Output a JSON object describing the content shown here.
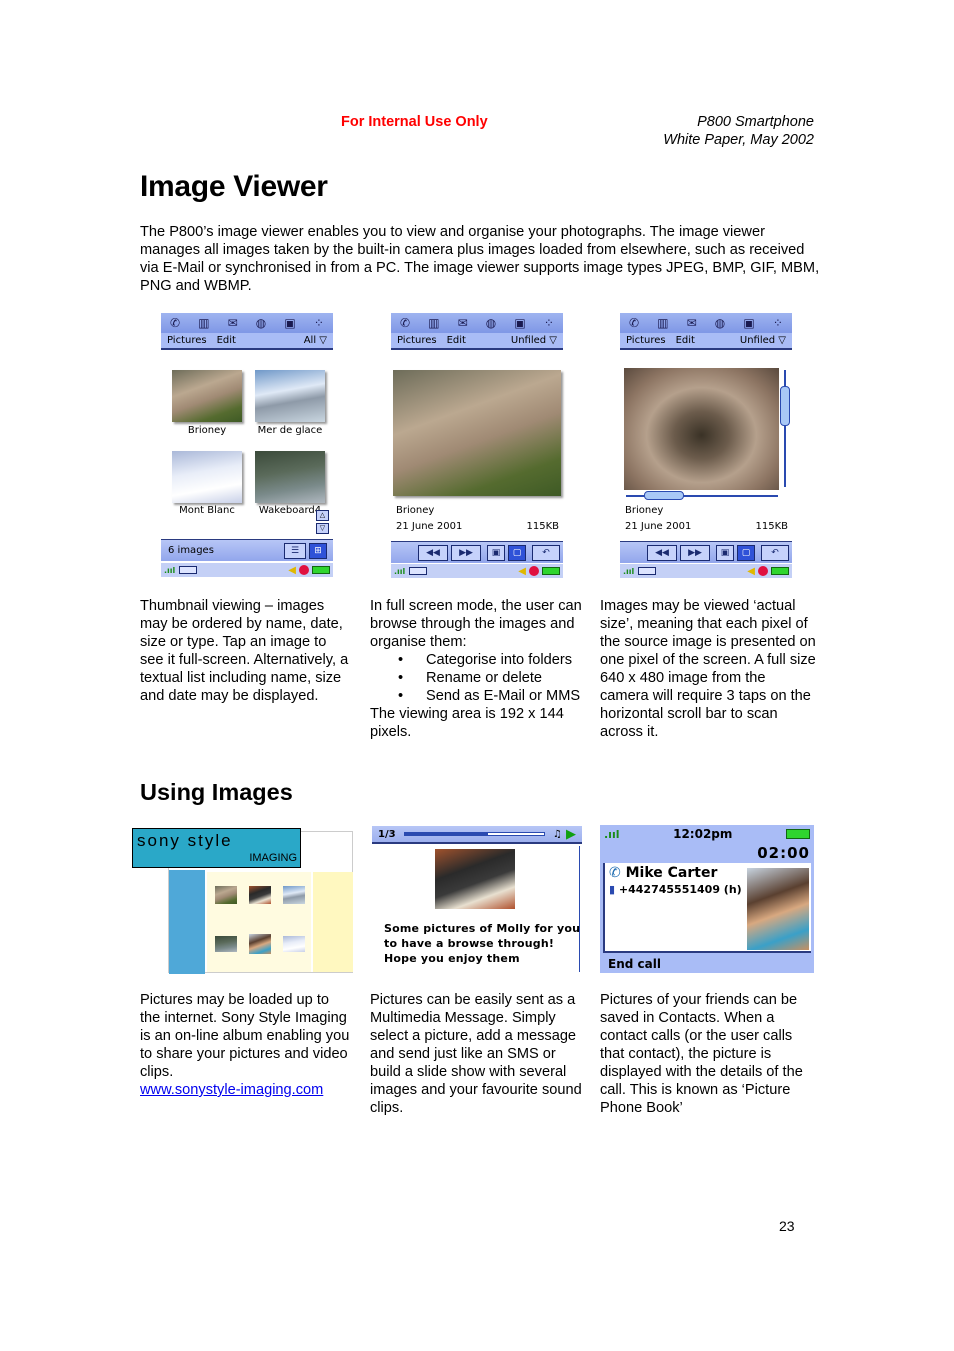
{
  "header": {
    "internal": "For Internal Use Only",
    "product": "P800 Smartphone",
    "doc": "White Paper, May 2002"
  },
  "title": "Image Viewer",
  "intro": "The P800’s image viewer enables you to view and organise your photographs.  The image viewer manages all images taken by the built-in camera plus images loaded from elsewhere, such as received via E-Mail or synchronised in from a PC. The image viewer supports image types JPEG, BMP, GIF, MBM, PNG and WBMP.",
  "screens": {
    "appbar_icons": [
      "phone-icon",
      "contacts-icon",
      "messages-icon",
      "web-icon",
      "calendar-icon",
      "apps-icon"
    ],
    "appbar_glyphs": [
      "✆",
      "▥",
      "✉",
      "◍",
      "▣",
      "⁘"
    ],
    "thumbnail": {
      "menu": [
        "Pictures",
        "Edit"
      ],
      "filter": "All ▽",
      "images": [
        {
          "label": "Brioney"
        },
        {
          "label": "Mer de glace"
        },
        {
          "label": "Mont Blanc"
        },
        {
          "label": "Wakeboard4"
        }
      ],
      "count": "6 images",
      "view_list": "☰",
      "view_grid": "⊞"
    },
    "fullscreen": {
      "menu": [
        "Pictures",
        "Edit"
      ],
      "filter": "Unfiled ▽",
      "name": "Brioney",
      "date": "21 June 2001",
      "size": "115KB",
      "buttons": [
        "◀◀",
        "▶▶",
        "▣",
        "▢",
        "↶"
      ]
    },
    "actual": {
      "menu": [
        "Pictures",
        "Edit"
      ],
      "filter": "Unfiled ▽",
      "name": "Brioney",
      "date": "21 June 2001",
      "size": "115KB",
      "buttons": [
        "◀◀",
        "▶▶",
        "▣",
        "▢",
        "↶"
      ]
    }
  },
  "captions": {
    "thumbnail": "Thumbnail viewing – images may be ordered by name, date, size or type. Tap an image to see it full-screen. Alternatively, a textual list including name, size and date may be displayed.",
    "fullscreen_intro": "In full screen mode, the user can browse through the images and organise them:",
    "fullscreen_bullets": [
      "Categorise into folders",
      "Rename or delete",
      "Send as E-Mail or MMS"
    ],
    "fullscreen_outro": "The viewing area is 192 x 144 pixels.",
    "actual": "Images may be viewed ‘actual size’, meaning that each pixel of the source image is presented on one pixel of the screen. A full size 640 x 480 image from the camera will require 3 taps on the horizontal scroll bar to scan across it."
  },
  "section2_title": "Using Images",
  "sony": {
    "logo_line1": "sony style",
    "logo_line2": "IMAGING"
  },
  "mms": {
    "counter": "1/3",
    "progress": 0.6,
    "music": "♫",
    "play": "▶",
    "message": "Some pictures of Molly for you to have a browse through! Hope you enjoy them"
  },
  "call": {
    "time": "12:02pm",
    "timer": "02:00",
    "name": "Mike Carter",
    "number": "+442745551409 (h)",
    "end": "End call"
  },
  "captions2": {
    "sony": "Pictures may be loaded up to the internet. Sony Style Imaging is an on-line album enabling you to share your pictures and video clips.",
    "sony_link": "www.sonystyle-imaging.com",
    "mms": "Pictures can be easily sent as a Multimedia Message. Simply select a picture, add a message and send just like an SMS or build a slide show with several images and your favourite sound clips.",
    "call": "Pictures of your friends can be saved in Contacts. When a contact calls (or the user calls that contact), the picture is displayed with the details of the call. This is known as ‘Picture Phone Book’"
  },
  "page_number": "23"
}
